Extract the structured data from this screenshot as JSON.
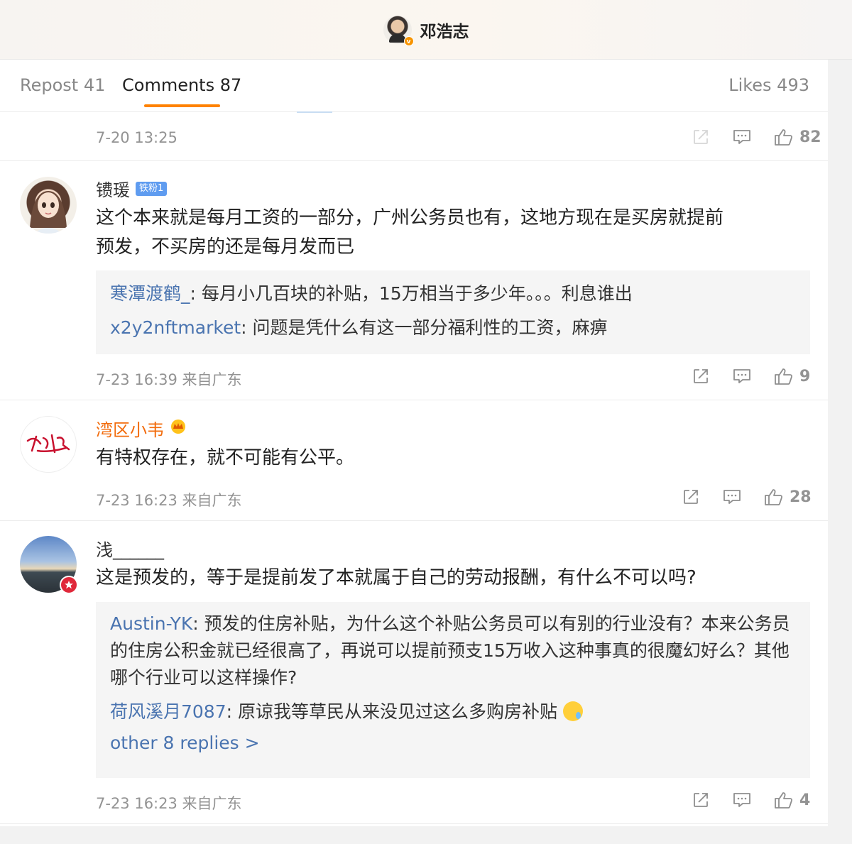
{
  "header": {
    "username": "邓浩志",
    "verified_badge": "v"
  },
  "tabs": {
    "repost": "Repost 41",
    "comments": "Comments 87",
    "likes": "Likes 493"
  },
  "first_row": {
    "time": "7-20 13:25",
    "like_count": "82"
  },
  "comments": [
    {
      "username": "镄瑗",
      "badge": "铁粉1",
      "text_line1": "这个本来就是每月工资的一部分，广州公务员也有，这地方现在是买房就提前",
      "text_line2": "预发，不买房的还是每月发而已",
      "replies": [
        {
          "name": "寒潭渡鹤_",
          "text": ": 每月小几百块的补贴，15万相当于多少年。。。利息谁出"
        },
        {
          "name": "x2y2nftmarket",
          "text": ": 问题是凭什么有这一部分福利性的工资，麻痹"
        }
      ],
      "meta": "7-23 16:39 来自广东",
      "like_count": "9"
    },
    {
      "username": "湾区小韦",
      "text_line1": "有特权存在，就不可能有公平。",
      "meta": "7-23 16:23 来自广东",
      "like_count": "28"
    },
    {
      "username": "浅______",
      "text_line1": "这是预发的，等于是提前发了本就属于自己的劳动报酬，有什么不可以吗?",
      "replies": [
        {
          "name": "Austin-YK",
          "text": ": 预发的住房补贴，为什么这个补贴公务员可以有别的行业没有？本来公务员的住房公积金就已经很高了，再说可以提前预支15万收入这种事真的很魔幻好么？其他哪个行业可以这样操作?"
        },
        {
          "name": "荷风溪月7087",
          "text": ": 原谅我等草民从来没见过这么多购房补贴"
        }
      ],
      "more_replies": "other 8 replies >",
      "meta": "7-23 16:23 来自广东",
      "like_count": "4"
    }
  ],
  "icons": [
    "share-icon",
    "comment-icon",
    "like-icon"
  ],
  "colors": {
    "accent": "#ff8200",
    "link": "#4a74b0",
    "orange_name": "#f26c0d",
    "fan_badge": "#5f9cf0"
  }
}
